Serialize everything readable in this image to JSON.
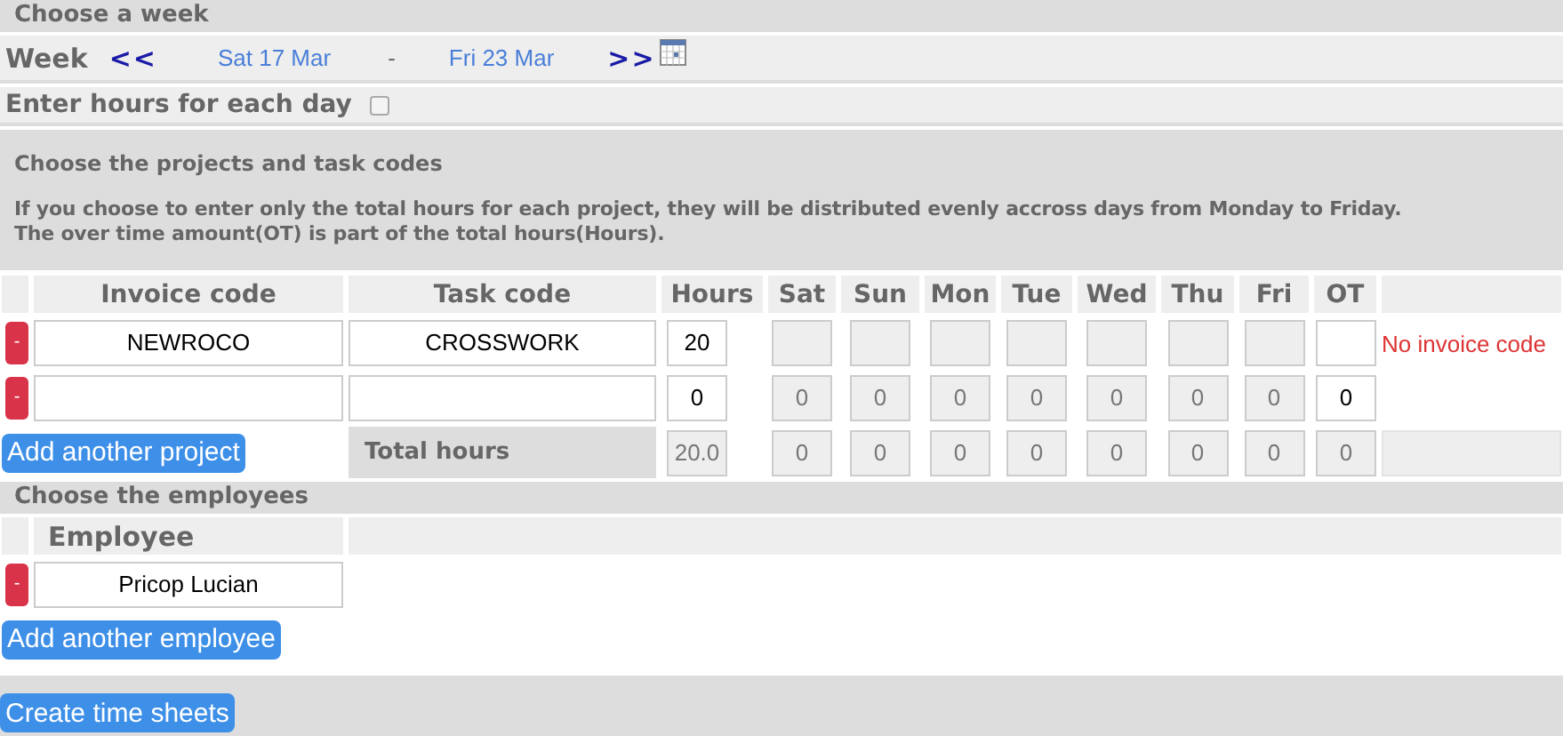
{
  "week_section": {
    "title": "Choose a week",
    "label": "Week",
    "prev": "<<",
    "start": "Sat 17 Mar",
    "separator": "-",
    "end": "Fri 23 Mar",
    "next": ">>"
  },
  "daily_hours": {
    "label": "Enter hours for each day",
    "checked": false
  },
  "projects": {
    "title": "Choose the projects and task codes",
    "note_lines": [
      "If you choose to enter only the total hours for each project, they will be distributed evenly accross days from Monday to Friday.",
      "The over time amount(OT) is part of the total hours(Hours)."
    ],
    "columns": [
      "Invoice code",
      "Task code",
      "Hours",
      "Sat",
      "Sun",
      "Mon",
      "Tue",
      "Wed",
      "Thu",
      "Fri",
      "OT"
    ],
    "rows": [
      {
        "remove": "-",
        "invoice_code": "NEWROCO",
        "task_code": "CROSSWORK",
        "hours": "20",
        "error": "No invoice code"
      },
      {
        "remove": "-",
        "hours": "0",
        "days": [
          "0",
          "0",
          "0",
          "0",
          "0",
          "0",
          "0"
        ],
        "ot": "0"
      }
    ],
    "add_button": "Add another project",
    "total": {
      "label": "Total hours",
      "hours": "20.0",
      "days": [
        "0",
        "0",
        "0",
        "0",
        "0",
        "0",
        "0"
      ],
      "ot": "0"
    }
  },
  "employees": {
    "title": "Choose the employees",
    "column": "Employee",
    "rows": [
      {
        "remove": "-",
        "name": "Pricop Lucian"
      }
    ],
    "add_button": "Add another employee"
  },
  "submit_button": "Create time sheets"
}
